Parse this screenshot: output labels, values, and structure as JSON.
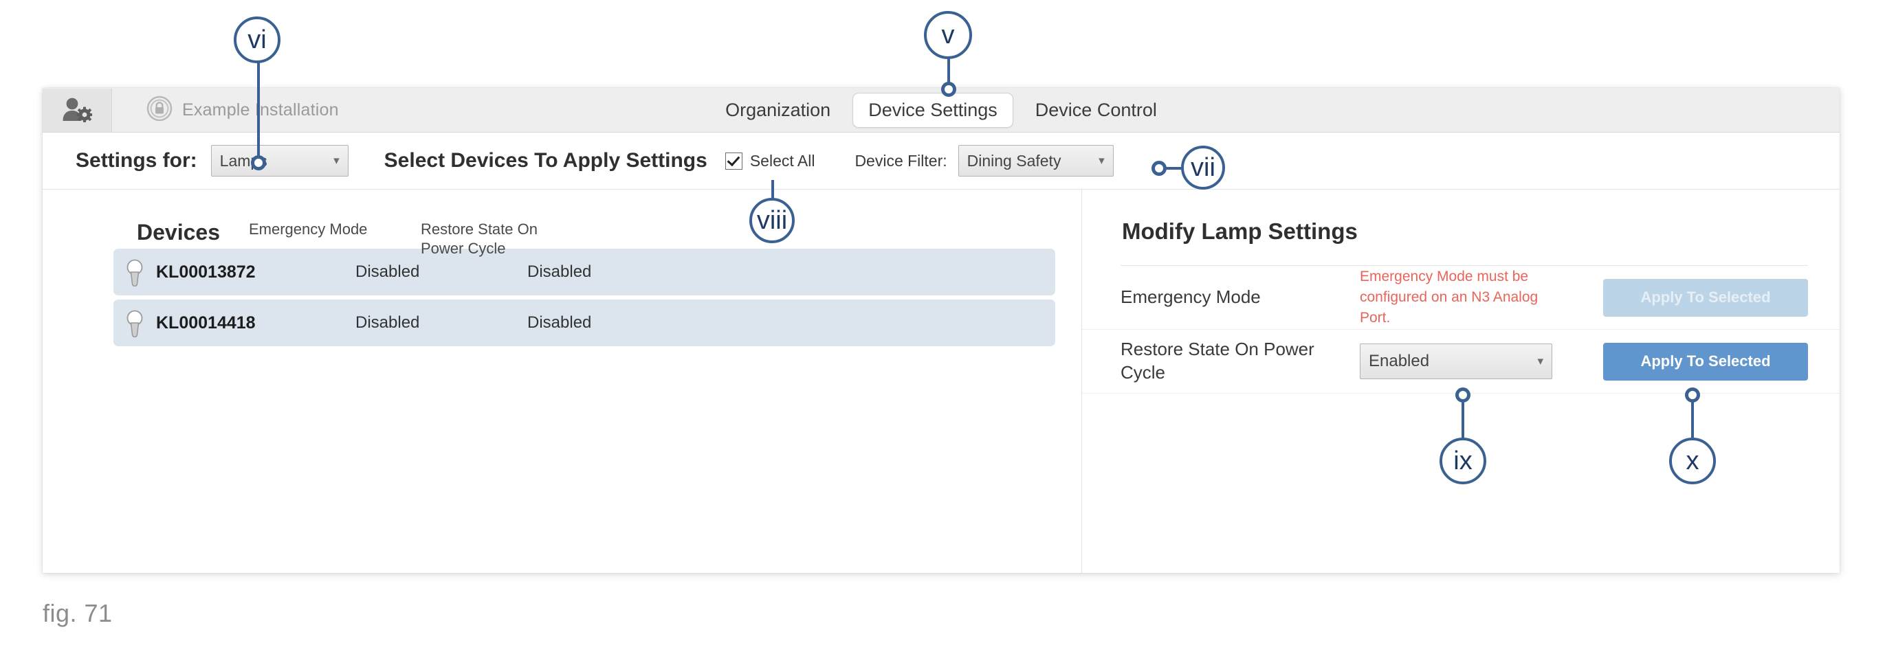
{
  "window": {
    "topbar": {
      "user_settings_icon": "person-gear-icon",
      "installation_icon": "padlock-circle-icon",
      "installation_name": "Example Installation"
    },
    "tabs": [
      {
        "label": "Organization",
        "active": false
      },
      {
        "label": "Device Settings",
        "active": true
      },
      {
        "label": "Device Control",
        "active": false
      }
    ],
    "settings_bar": {
      "settings_for_label": "Settings for:",
      "settings_for_value": "Lamps",
      "select_devices_title": "Select Devices To Apply Settings",
      "select_all_label": "Select All",
      "select_all_checked": true,
      "device_filter_label": "Device Filter:",
      "device_filter_value": "Dining Safety",
      "caret_icon": "chevron-down-icon"
    },
    "devices_panel": {
      "columns": [
        "Devices",
        "Emergency Mode",
        "Restore State On\nPower Cycle"
      ],
      "col_devices": "Devices",
      "col_emergency": "Emergency Mode",
      "col_restore_line1": "Restore State On",
      "col_restore_line2": "Power Cycle",
      "rows": [
        {
          "icon": "lightbulb-icon",
          "name": "KL00013872",
          "emergency_mode": "Disabled",
          "restore_state": "Disabled",
          "selected": true
        },
        {
          "icon": "lightbulb-icon",
          "name": "KL00014418",
          "emergency_mode": "Disabled",
          "restore_state": "Disabled",
          "selected": true
        }
      ]
    },
    "modify_panel": {
      "title": "Modify Lamp Settings",
      "emergency_row": {
        "label": "Emergency Mode",
        "warning": "Emergency Mode must be configured on an N3 Analog Port.",
        "button_label": "Apply To Selected",
        "button_disabled": true
      },
      "restore_row": {
        "label": "Restore State On Power Cycle",
        "select_value": "Enabled",
        "button_label": "Apply To Selected",
        "button_disabled": false
      }
    }
  },
  "callouts": [
    {
      "id": "vi",
      "label": "vi"
    },
    {
      "id": "v",
      "label": "v"
    },
    {
      "id": "vii",
      "label": "vii"
    },
    {
      "id": "viii",
      "label": "viii"
    },
    {
      "id": "ix",
      "label": "ix"
    },
    {
      "id": "x",
      "label": "x"
    }
  ],
  "caption": "fig. 71",
  "colors": {
    "callout_blue": "#3a6191",
    "accent_button": "#6195cd",
    "button_disabled": "#bcd4e8",
    "row_selected": "#dce5ee",
    "warning_red": "#e8655a"
  }
}
